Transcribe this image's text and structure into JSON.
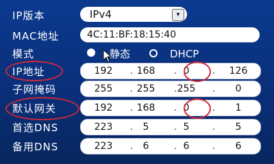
{
  "rows": {
    "ip_version": {
      "label": "IP版本",
      "value": "IPv4"
    },
    "mac": {
      "label": "MAC地址",
      "value": "4C:11:BF:18:15:40"
    },
    "mode": {
      "label": "模式",
      "option_static": "静态",
      "option_dhcp": "DHCP"
    },
    "ip": {
      "label": "IP地址",
      "octets": [
        "192",
        "168",
        "0",
        "126"
      ]
    },
    "mask": {
      "label": "子网掩码",
      "octets": [
        "255",
        "255",
        "255",
        "0"
      ]
    },
    "gateway": {
      "label": "默认网关",
      "octets": [
        "192",
        "168",
        "0",
        "1"
      ]
    },
    "dns1": {
      "label": "首选DNS",
      "octets": [
        "223",
        "5",
        "5",
        "5"
      ]
    },
    "dns2": {
      "label": "备用DNS",
      "octets": [
        "223",
        "6",
        "6",
        "6"
      ]
    }
  },
  "icons": {
    "dropdown": "chevron-down-icon",
    "cursor": "mouse-pointer-icon"
  },
  "colors": {
    "background": "#0a2f7a",
    "annotation": "#d0283a"
  }
}
